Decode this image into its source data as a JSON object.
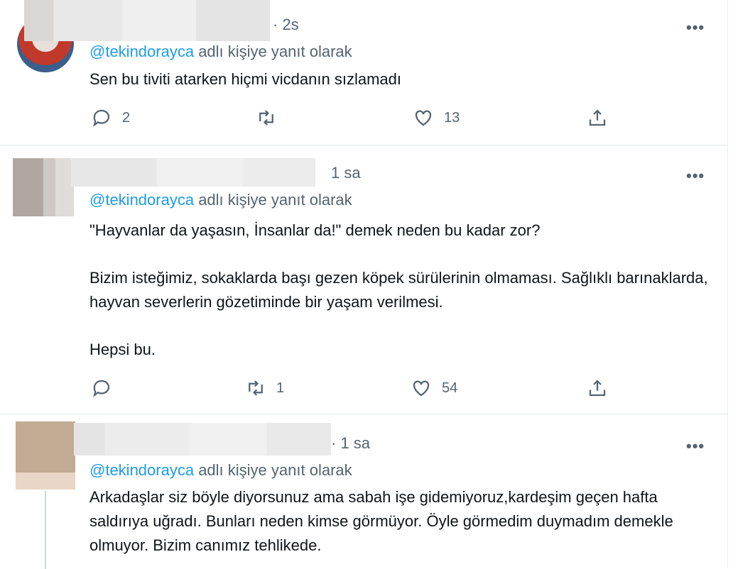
{
  "tweets": [
    {
      "time": "· 2s",
      "reply_prefix_handle": "@tekindorayca",
      "reply_suffix": " adlı kişiye yanıt olarak",
      "text": "Sen bu tiviti atarken hiçmi vicdanın sızlamadı",
      "reply_count": "2",
      "retweet_count": "",
      "like_count": "13",
      "avatar_color": "#c0392b"
    },
    {
      "time": "1 sa",
      "reply_prefix_handle": "@tekindorayca",
      "reply_suffix": " adlı kişiye yanıt olarak",
      "text": "\"Hayvanlar da yaşasın, İnsanlar da!\" demek neden bu kadar zor?\n\nBizim isteğimiz, sokaklarda başı gezen köpek sürülerinin olmaması. Sağlıklı barınaklarda, hayvan severlerin gözetiminde bir yaşam verilmesi.\n\nHepsi bu.",
      "reply_count": "",
      "retweet_count": "1",
      "like_count": "54",
      "avatar_color": "#8a7f7a"
    },
    {
      "time": "· 1 sa",
      "reply_prefix_handle": "@tekindorayca",
      "reply_suffix": " adlı kişiye yanıt olarak",
      "text": "Arkadaşlar siz böyle diyorsunuz ama sabah işe gidemiyoruz,kardeşim geçen hafta saldırıya uğradı. Bunları neden kimse görmüyor. Öyle görmedim duymadım demekle olmuyor. Bizim canımız tehlikede.",
      "avatar_color": "#b79c86"
    }
  ],
  "more_glyph": "•••",
  "icons": [
    "reply-icon",
    "retweet-icon",
    "like-icon",
    "share-icon",
    "more-icon"
  ]
}
